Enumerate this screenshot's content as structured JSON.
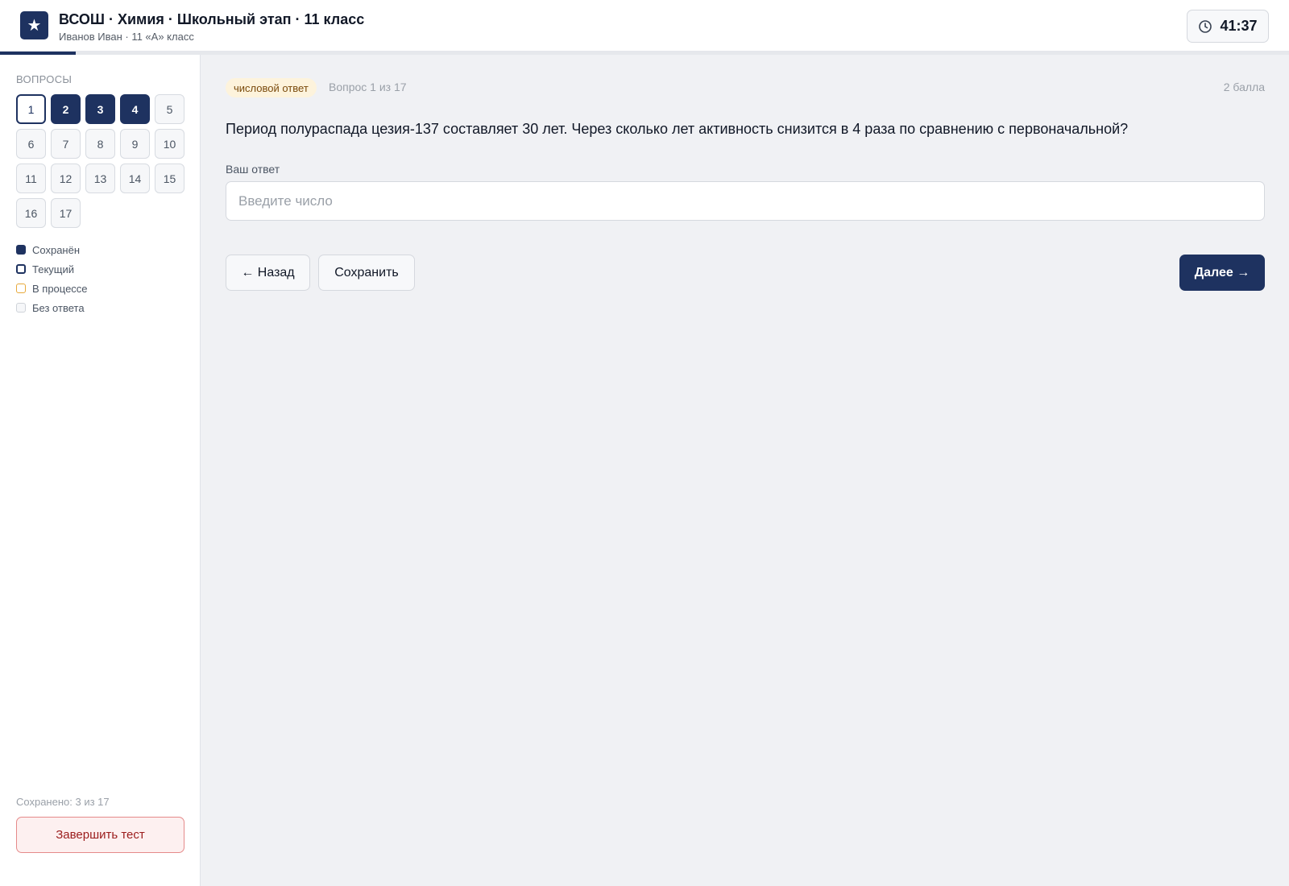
{
  "header": {
    "logo_glyph": "★",
    "title": "ВСОШ · Химия · Школьный этап · 11 класс",
    "subtitle": "Иванов Иван · 11 «А» класс",
    "timer": "41:37",
    "progress_fraction": 0.059
  },
  "sidebar": {
    "heading": "ВОПРОСЫ",
    "questions": [
      {
        "label": "1",
        "state": "current"
      },
      {
        "label": "2",
        "state": "saved"
      },
      {
        "label": "3",
        "state": "saved"
      },
      {
        "label": "4",
        "state": "saved"
      },
      {
        "label": "5",
        "state": "none"
      },
      {
        "label": "6",
        "state": "none"
      },
      {
        "label": "7",
        "state": "none"
      },
      {
        "label": "8",
        "state": "none"
      },
      {
        "label": "9",
        "state": "none"
      },
      {
        "label": "10",
        "state": "none"
      },
      {
        "label": "11",
        "state": "none"
      },
      {
        "label": "12",
        "state": "none"
      },
      {
        "label": "13",
        "state": "none"
      },
      {
        "label": "14",
        "state": "none"
      },
      {
        "label": "15",
        "state": "none"
      },
      {
        "label": "16",
        "state": "none"
      },
      {
        "label": "17",
        "state": "none"
      }
    ],
    "legend": [
      {
        "label": "Сохранён",
        "kind": "saved"
      },
      {
        "label": "Текущий",
        "kind": "current"
      },
      {
        "label": "В процессе",
        "kind": "progress"
      },
      {
        "label": "Без ответа",
        "kind": "none"
      }
    ],
    "saved_count": "Сохранено: 3 из 17",
    "finish_label": "Завершить тест"
  },
  "main": {
    "tag": "числовой ответ",
    "counter": "Вопрос 1 из 17",
    "points": "2 балла",
    "question": "Период полураспада цезия-137 составляет 30 лет. Через сколько лет активность снизится в 4 раза по сравнению с первоначальной?",
    "answer_label": "Ваш ответ",
    "answer_placeholder": "Введите число",
    "answer_value": "",
    "back_label": "← Назад",
    "save_label": "Сохранить",
    "next_label": "Далее →"
  },
  "colors": {
    "primary": "#1e3260",
    "tag_bg": "#fdf3dc",
    "danger": "#9b1c1c",
    "in_progress": "#e7a93a"
  }
}
